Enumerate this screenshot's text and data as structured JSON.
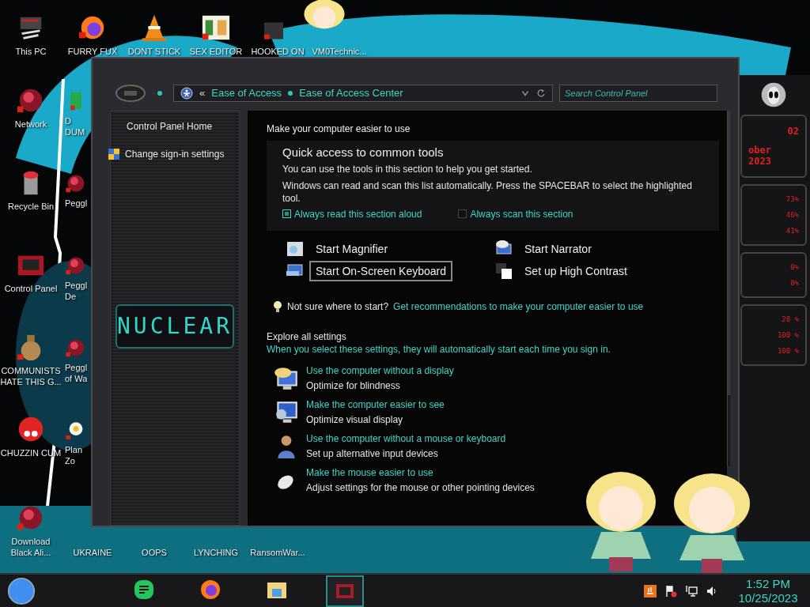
{
  "desktop": {
    "top_row": [
      {
        "label": "This PC",
        "kind": "computer"
      },
      {
        "label": "FURRY FUX",
        "kind": "browser"
      },
      {
        "label": "DONT STICK",
        "kind": "cone"
      },
      {
        "label": "SEX EDITOR",
        "kind": "editor"
      },
      {
        "label": "HOOKED ON",
        "kind": "app"
      },
      {
        "label": "VM0Technic...",
        "kind": "none"
      }
    ],
    "left_columns": [
      [
        {
          "label": "Network",
          "kind": "sphere"
        },
        {
          "label": "Recycle Bin",
          "kind": "bin"
        },
        {
          "label": "Control Panel",
          "kind": "panel"
        },
        {
          "label": "COMMUNISTS HATE THIS G...",
          "kind": "money"
        },
        {
          "label": "CHUZZIN CUM",
          "kind": "creature"
        }
      ],
      [
        {
          "label": "D DUM",
          "kind": "app"
        },
        {
          "label": "Peggl",
          "kind": "sphere"
        },
        {
          "label": "Peggl De",
          "kind": "sphere"
        },
        {
          "label": "Peggl of Wa",
          "kind": "sphere"
        },
        {
          "label": "Plan Zo",
          "kind": "flower"
        }
      ]
    ],
    "bottom_row": [
      {
        "label": "Download Black Ali...",
        "kind": "sphere"
      },
      {
        "label": "UKRAINE",
        "kind": "none"
      },
      {
        "label": "OOPS",
        "kind": "none"
      },
      {
        "label": "LYNCHING",
        "kind": "none"
      },
      {
        "label": "RansomWar...",
        "kind": "none"
      }
    ]
  },
  "window": {
    "breadcrumb": [
      "Ease of Access",
      "Ease of Access Center"
    ],
    "breadcrumb_back": "«",
    "search": {
      "placeholder": "Search Control Panel"
    },
    "sidebar": {
      "links": [
        {
          "label": "Control Panel Home",
          "kind": "plain"
        },
        {
          "label": "Change sign-in settings",
          "kind": "icon"
        }
      ],
      "logo": "NUCLEAR"
    },
    "heading": "Make your computer easier to use",
    "quick_access": {
      "title": "Quick access to common tools",
      "text": "You can use the tools in this section to help you get started.",
      "note": "Windows can read and scan this list automatically.  Press the SPACEBAR to select the highlighted tool.",
      "options": [
        {
          "label": "Always read this section aloud",
          "checked": true
        },
        {
          "label": "Always scan this section",
          "checked": false
        }
      ],
      "tools": [
        {
          "label": "Start Magnifier",
          "kind": "magnifier",
          "selected": false
        },
        {
          "label": "Start Narrator",
          "kind": "narrator",
          "selected": false
        },
        {
          "label": "Start On-Screen Keyboard",
          "kind": "keyboard",
          "selected": true
        },
        {
          "label": "Set up High Contrast",
          "kind": "contrast",
          "selected": false
        }
      ]
    },
    "tip": {
      "text": "Not sure where to start?",
      "link": "Get recommendations to make your computer easier to use"
    },
    "explore": {
      "title": "Explore all settings",
      "subtitle": "When you select these settings, they will automatically start each time you sign in.",
      "items": [
        {
          "link": "Use the computer without a display",
          "description": "Optimize for blindness",
          "kind": "speech"
        },
        {
          "link": "Make the computer easier to see",
          "description": "Optimize visual display",
          "kind": "display"
        },
        {
          "link": "Use the computer without a mouse or keyboard",
          "description": "Set up alternative input devices",
          "kind": "person"
        },
        {
          "link": "Make the mouse easier to use",
          "description": "Adjust settings for the mouse or other pointing devices",
          "kind": "mouse"
        }
      ]
    }
  },
  "gadget": {
    "panels": [
      {
        "readings": [
          "02",
          "ober 2023"
        ]
      },
      {
        "readings": [
          "73%",
          "46%",
          "41%"
        ]
      },
      {
        "readings": [
          "0%",
          "0%"
        ]
      },
      {
        "readings": [
          "28 %",
          "100 %",
          "100 %"
        ]
      }
    ]
  },
  "taskbar": {
    "apps": [
      {
        "kind": "chat",
        "selected": false
      },
      {
        "kind": "browser",
        "selected": false
      },
      {
        "kind": "folder",
        "selected": false
      },
      {
        "kind": "app",
        "selected": true
      }
    ],
    "tray": [
      {
        "kind": "java"
      },
      {
        "kind": "flag"
      },
      {
        "kind": "network"
      },
      {
        "kind": "volume"
      }
    ],
    "time": "1:52 PM",
    "date": "10/25/2023"
  }
}
